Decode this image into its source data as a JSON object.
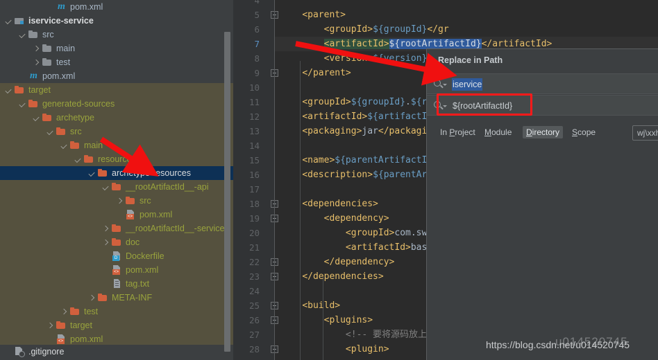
{
  "sidebar": {
    "scrollbar": "vertical-scrollbar",
    "tree": [
      {
        "depth": 4,
        "twisty": "none",
        "icon": "maven-icon",
        "label": "pom.xml",
        "style": "gray",
        "bg": "normal"
      },
      {
        "depth": 1,
        "twisty": "down",
        "icon": "module-icon",
        "label": "iservice-service",
        "style": "bold",
        "bg": "normal"
      },
      {
        "depth": 2,
        "twisty": "down",
        "icon": "folder-gray-icon",
        "label": "src",
        "style": "gray",
        "bg": "normal"
      },
      {
        "depth": 3,
        "twisty": "right",
        "icon": "folder-gray-icon",
        "label": "main",
        "style": "gray",
        "bg": "normal"
      },
      {
        "depth": 3,
        "twisty": "right",
        "icon": "folder-gray-icon",
        "label": "test",
        "style": "gray",
        "bg": "normal"
      },
      {
        "depth": 2,
        "twisty": "none",
        "icon": "maven-icon",
        "label": "pom.xml",
        "style": "gray",
        "bg": "normal"
      },
      {
        "depth": 1,
        "twisty": "down",
        "icon": "folder-orange-icon",
        "label": "target",
        "style": "olive",
        "bg": "excluded"
      },
      {
        "depth": 2,
        "twisty": "down",
        "icon": "folder-orange-icon",
        "label": "generated-sources",
        "style": "olive",
        "bg": "excluded"
      },
      {
        "depth": 3,
        "twisty": "down",
        "icon": "folder-orange-icon",
        "label": "archetype",
        "style": "olive",
        "bg": "excluded"
      },
      {
        "depth": 4,
        "twisty": "down",
        "icon": "folder-orange-icon",
        "label": "src",
        "style": "olive",
        "bg": "excluded"
      },
      {
        "depth": 5,
        "twisty": "down",
        "icon": "folder-orange-icon",
        "label": "main",
        "style": "olive",
        "bg": "excluded"
      },
      {
        "depth": 6,
        "twisty": "down",
        "icon": "folder-orange-icon",
        "label": "resources",
        "style": "olive",
        "bg": "excluded"
      },
      {
        "depth": 7,
        "twisty": "down",
        "icon": "folder-orange-icon",
        "label": "archetype-resources",
        "style": "sel",
        "bg": "selected"
      },
      {
        "depth": 8,
        "twisty": "down",
        "icon": "folder-orange-icon",
        "label": "__rootArtifactId__-api",
        "style": "olive",
        "bg": "excluded"
      },
      {
        "depth": 9,
        "twisty": "right",
        "icon": "folder-orange-icon",
        "label": "src",
        "style": "olive",
        "bg": "excluded"
      },
      {
        "depth": 9,
        "twisty": "none",
        "icon": "xml-file-icon",
        "label": "pom.xml",
        "style": "olive",
        "bg": "excluded"
      },
      {
        "depth": 8,
        "twisty": "right",
        "icon": "folder-orange-icon",
        "label": "__rootArtifactId__-service",
        "style": "olive",
        "bg": "excluded"
      },
      {
        "depth": 8,
        "twisty": "right",
        "icon": "folder-orange-icon",
        "label": "doc",
        "style": "olive",
        "bg": "excluded"
      },
      {
        "depth": 8,
        "twisty": "none",
        "icon": "docker-file-icon",
        "label": "Dockerfile",
        "style": "olive",
        "bg": "excluded"
      },
      {
        "depth": 8,
        "twisty": "none",
        "icon": "xml-file-icon",
        "label": "pom.xml",
        "style": "olive",
        "bg": "excluded"
      },
      {
        "depth": 8,
        "twisty": "none",
        "icon": "txt-file-icon",
        "label": "tag.txt",
        "style": "olive",
        "bg": "excluded"
      },
      {
        "depth": 7,
        "twisty": "right",
        "icon": "folder-orange-icon",
        "label": "META-INF",
        "style": "olive",
        "bg": "excluded"
      },
      {
        "depth": 5,
        "twisty": "right",
        "icon": "folder-orange-icon",
        "label": "test",
        "style": "olive",
        "bg": "excluded"
      },
      {
        "depth": 4,
        "twisty": "right",
        "icon": "folder-orange-icon",
        "label": "target",
        "style": "olive",
        "bg": "excluded"
      },
      {
        "depth": 4,
        "twisty": "none",
        "icon": "xml-file-icon",
        "label": "pom.xml",
        "style": "olive",
        "bg": "excluded"
      },
      {
        "depth": 1,
        "twisty": "none",
        "icon": "ignore-file-icon",
        "label": ".gitignore",
        "style": "white",
        "bg": "bottomrow"
      }
    ]
  },
  "editor": {
    "first_visible_line": 4,
    "current_line": 7,
    "lines": [
      {
        "num": 4,
        "indent": 0,
        "segments": []
      },
      {
        "num": 5,
        "indent": 0,
        "fold": true,
        "segments": [
          {
            "t": "    ",
            "c": "txt"
          },
          {
            "t": "<parent>",
            "c": "tag"
          }
        ]
      },
      {
        "num": 6,
        "indent": 0,
        "segments": [
          {
            "t": "        ",
            "c": "txt"
          },
          {
            "t": "<groupId>",
            "c": "tag"
          },
          {
            "t": "${groupId}",
            "c": "var"
          },
          {
            "t": "</gr",
            "c": "tag"
          }
        ]
      },
      {
        "num": 7,
        "indent": 0,
        "current": true,
        "segments": [
          {
            "t": "        ",
            "c": "txt"
          },
          {
            "t": "<artifactId>",
            "c": "tag hl-green"
          },
          {
            "t": "${rootArtifactId}",
            "c": "hl-blue"
          },
          {
            "t": "</artifactId>",
            "c": "tag"
          }
        ]
      },
      {
        "num": 8,
        "indent": 0,
        "segments": [
          {
            "t": "        ",
            "c": "txt"
          },
          {
            "t": "<version>",
            "c": "tag"
          },
          {
            "t": "${version}",
            "c": "var"
          }
        ]
      },
      {
        "num": 9,
        "indent": 0,
        "fold": true,
        "segments": [
          {
            "t": "    ",
            "c": "txt"
          },
          {
            "t": "</parent>",
            "c": "tag"
          }
        ]
      },
      {
        "num": 10,
        "indent": 0,
        "segments": []
      },
      {
        "num": 11,
        "indent": 0,
        "segments": [
          {
            "t": "    ",
            "c": "txt"
          },
          {
            "t": "<groupId>",
            "c": "tag"
          },
          {
            "t": "${groupId}",
            "c": "var"
          },
          {
            "t": ".",
            "c": "txt"
          },
          {
            "t": "${r",
            "c": "var"
          }
        ]
      },
      {
        "num": 12,
        "indent": 0,
        "segments": [
          {
            "t": "    ",
            "c": "txt"
          },
          {
            "t": "<artifactId>",
            "c": "tag"
          },
          {
            "t": "${artifactI",
            "c": "var"
          }
        ]
      },
      {
        "num": 13,
        "indent": 0,
        "segments": [
          {
            "t": "    ",
            "c": "txt"
          },
          {
            "t": "<packaging>",
            "c": "tag"
          },
          {
            "t": "jar",
            "c": "txt"
          },
          {
            "t": "</packagi",
            "c": "tag"
          }
        ]
      },
      {
        "num": 14,
        "indent": 0,
        "segments": []
      },
      {
        "num": 15,
        "indent": 0,
        "segments": [
          {
            "t": "    ",
            "c": "txt"
          },
          {
            "t": "<name>",
            "c": "tag"
          },
          {
            "t": "${parentArtifactI",
            "c": "var"
          }
        ]
      },
      {
        "num": 16,
        "indent": 0,
        "segments": [
          {
            "t": "    ",
            "c": "txt"
          },
          {
            "t": "<description>",
            "c": "tag"
          },
          {
            "t": "${parentAr",
            "c": "var"
          }
        ]
      },
      {
        "num": 17,
        "indent": 0,
        "segments": []
      },
      {
        "num": 18,
        "indent": 0,
        "fold": true,
        "segments": [
          {
            "t": "    ",
            "c": "txt"
          },
          {
            "t": "<dependencies>",
            "c": "tag"
          }
        ]
      },
      {
        "num": 19,
        "indent": 0,
        "fold": true,
        "segments": [
          {
            "t": "        ",
            "c": "txt"
          },
          {
            "t": "<dependency>",
            "c": "tag"
          }
        ]
      },
      {
        "num": 20,
        "indent": 0,
        "segments": [
          {
            "t": "            ",
            "c": "txt"
          },
          {
            "t": "<groupId>",
            "c": "tag"
          },
          {
            "t": "com.sw",
            "c": "txt"
          }
        ]
      },
      {
        "num": 21,
        "indent": 0,
        "segments": [
          {
            "t": "            ",
            "c": "txt"
          },
          {
            "t": "<artifactId>",
            "c": "tag"
          },
          {
            "t": "bas",
            "c": "txt"
          }
        ]
      },
      {
        "num": 22,
        "indent": 0,
        "fold": true,
        "segments": [
          {
            "t": "        ",
            "c": "txt"
          },
          {
            "t": "</dependency>",
            "c": "tag"
          }
        ]
      },
      {
        "num": 23,
        "indent": 0,
        "fold": true,
        "segments": [
          {
            "t": "    ",
            "c": "txt"
          },
          {
            "t": "</dependencies>",
            "c": "tag"
          }
        ]
      },
      {
        "num": 24,
        "indent": 0,
        "segments": []
      },
      {
        "num": 25,
        "indent": 0,
        "fold": true,
        "segments": [
          {
            "t": "    ",
            "c": "txt"
          },
          {
            "t": "<build>",
            "c": "tag"
          }
        ]
      },
      {
        "num": 26,
        "indent": 0,
        "fold": true,
        "segments": [
          {
            "t": "        ",
            "c": "txt"
          },
          {
            "t": "<plugins>",
            "c": "tag"
          }
        ]
      },
      {
        "num": 27,
        "indent": 0,
        "segments": [
          {
            "t": "            ",
            "c": "txt"
          },
          {
            "t": "<!-- 要将源码放上",
            "c": "cmt"
          }
        ]
      },
      {
        "num": 28,
        "indent": 0,
        "fold": true,
        "segments": [
          {
            "t": "            ",
            "c": "txt"
          },
          {
            "t": "<plugin>",
            "c": "tag"
          }
        ]
      }
    ]
  },
  "dialog": {
    "title": "Replace in Path",
    "search": {
      "value": "iservice",
      "icon": "search-icon"
    },
    "replace": {
      "value": "${rootArtifactId}",
      "icon": "search-icon"
    },
    "scope_options": [
      {
        "label": "In Project",
        "mnemonic": "P",
        "active": false
      },
      {
        "label": "Module",
        "mnemonic": "M",
        "active": false
      },
      {
        "label": "Directory",
        "mnemonic": "D",
        "active": true
      },
      {
        "label": "Scope",
        "mnemonic": "S",
        "active": false
      }
    ],
    "scope_path": "wj\\xxh\\iserv",
    "highlight_color": "#ff1a1a"
  },
  "annotations": {
    "arrow_color": "#f01010",
    "arrow_1_target": "replace-in-path-dialog-title",
    "arrow_2_target": "archetype-resources-tree-node"
  },
  "watermark": {
    "url": "https://blog.csdn.net/u014520745",
    "overlay": "u014520745"
  }
}
